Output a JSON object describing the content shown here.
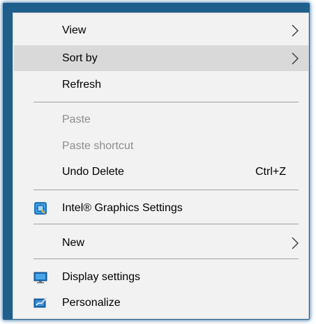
{
  "menu": {
    "items": [
      {
        "label": "View",
        "has_submenu": true
      },
      {
        "label": "Sort by",
        "has_submenu": true,
        "highlighted": true
      },
      {
        "label": "Refresh"
      },
      {
        "label": "Paste",
        "disabled": true
      },
      {
        "label": "Paste shortcut",
        "disabled": true
      },
      {
        "label": "Undo Delete",
        "shortcut": "Ctrl+Z"
      },
      {
        "label": "Intel® Graphics Settings",
        "icon": "intel-graphics-icon"
      },
      {
        "label": "New",
        "has_submenu": true
      },
      {
        "label": "Display settings",
        "icon": "display-settings-icon"
      },
      {
        "label": "Personalize",
        "icon": "personalize-icon"
      }
    ]
  },
  "colors": {
    "frame_border": "#1f5f8c",
    "menu_background": "#f2f2f2",
    "highlight": "#d9d9d9",
    "disabled_text": "#8d8d8d",
    "separator": "#a0a0a0"
  }
}
